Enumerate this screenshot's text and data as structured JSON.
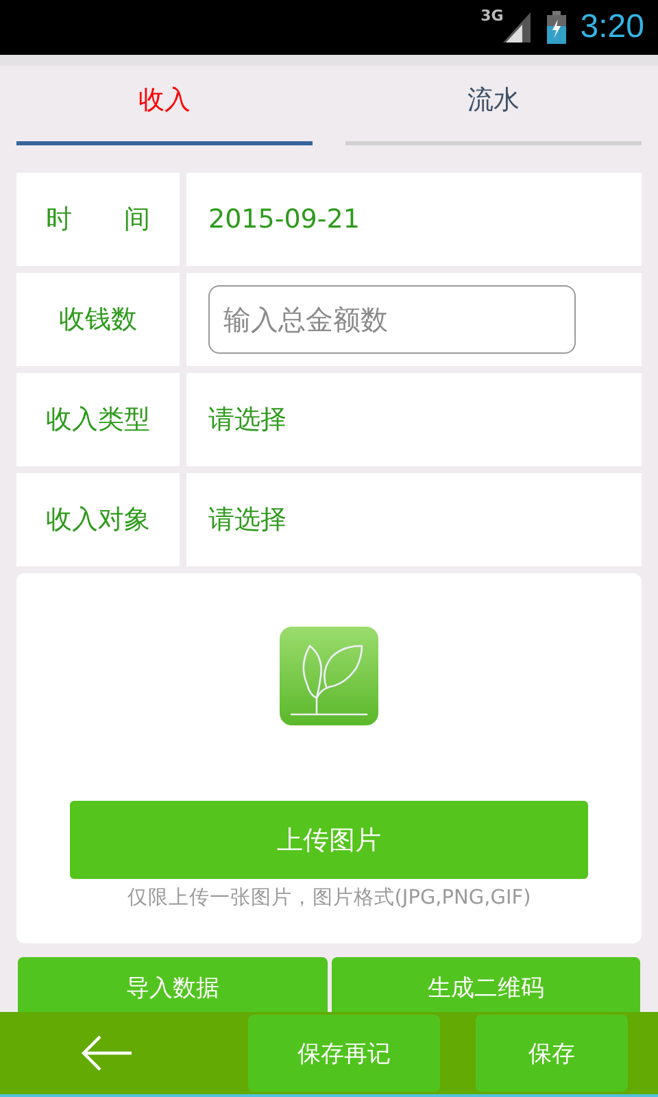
{
  "status_bar": {
    "network": "3G",
    "time": "3:20"
  },
  "tabs": [
    {
      "label": "收入",
      "selected": true
    },
    {
      "label": "流水",
      "selected": false
    }
  ],
  "form_rows": [
    {
      "kind": "text",
      "label": "时　　间",
      "value": "2015-09-21"
    },
    {
      "kind": "input",
      "label": "收钱数",
      "placeholder": "输入总金额数"
    },
    {
      "kind": "select",
      "label": "收入类型",
      "value": "请选择"
    },
    {
      "kind": "select",
      "label": "收入对象",
      "value": "请选择"
    }
  ],
  "upload": {
    "button": "上传图片",
    "hint": "仅限上传一张图片，图片格式(JPG,PNG,GIF)"
  },
  "actions": [
    "导入数据",
    "生成二维码"
  ],
  "bottom_bar": {
    "buttons": [
      "保存再记",
      "保存"
    ]
  }
}
